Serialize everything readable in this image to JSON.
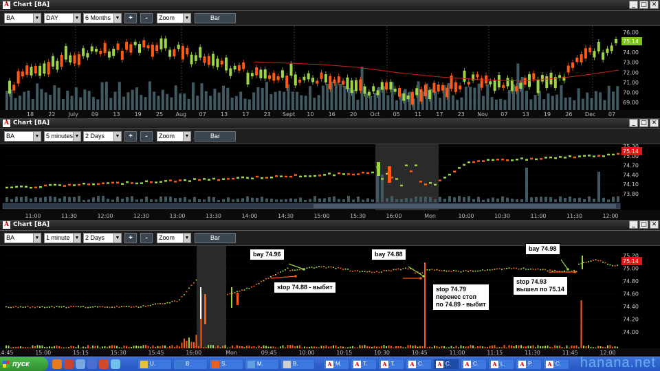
{
  "colors": {
    "up": "#9ed447",
    "down": "#ff5a14",
    "volume": "#3f5a62",
    "ma": "#d21e1e",
    "grid": "#3a3a3a",
    "price_tag_green": "#7cc417",
    "price_tag_red": "#e01818"
  },
  "windows": [
    {
      "title": "Chart [BA]",
      "symbol": "BA",
      "interval": "DAY",
      "range": "6 Months",
      "mode": "Zoom",
      "bar_label": "Bar",
      "plus": "+",
      "minus": "-",
      "last_price": "75.14",
      "x_labels": [
        "18",
        "22",
        "July",
        "09",
        "13",
        "19",
        "25",
        "Aug",
        "07",
        "13",
        "17",
        "23",
        "Sept",
        "10",
        "16",
        "20",
        "Oct",
        "05",
        "11",
        "17",
        "23",
        "Nov",
        "07",
        "13",
        "19",
        "26",
        "Dec",
        "07"
      ],
      "y_labels": [
        "76.00",
        "75.00",
        "74.00",
        "73.00",
        "72.00",
        "71.00",
        "70.00",
        "69.00"
      ]
    },
    {
      "title": "Chart [BA]",
      "symbol": "BA",
      "interval": "5 minutes",
      "range": "2 Days",
      "mode": "Zoom",
      "bar_label": "Bar",
      "plus": "+",
      "minus": "-",
      "last_price": "75.14",
      "x_labels": [
        "11:00",
        "11:30",
        "12:00",
        "12:30",
        "13:00",
        "13:30",
        "14:00",
        "14:30",
        "15:00",
        "15:30",
        "16:00",
        "Mon",
        "10:00",
        "10:30",
        "11:00",
        "11:30",
        "12:00"
      ],
      "y_labels": [
        "75.30",
        "75.00",
        "74.70",
        "74.40",
        "74.10",
        "73.80"
      ]
    },
    {
      "title": "Chart [BA]",
      "symbol": "BA",
      "interval": "1 minute",
      "range": "2 Days",
      "mode": "Zoom",
      "bar_label": "Bar",
      "plus": "+",
      "minus": "-",
      "last_price": "75.14",
      "x_labels": [
        "14:45",
        "15:00",
        "15:15",
        "15:30",
        "15:45",
        "16:00",
        "Mon",
        "09:45",
        "10:00",
        "10:15",
        "10:30",
        "10:45",
        "11:00",
        "11:15",
        "11:30",
        "11:45",
        "12:00"
      ],
      "y_labels": [
        "75.20",
        "75.00",
        "74.80",
        "74.60",
        "74.40",
        "74.20",
        "74.00"
      ],
      "annotations": [
        {
          "id": "bay1",
          "text": "bay 74.96"
        },
        {
          "id": "stop1",
          "text": "stop 74.88 - выбит"
        },
        {
          "id": "bay2",
          "text": "bay 74.88"
        },
        {
          "id": "stop2",
          "text": "stop 74.79\nперенес стоп\nпо 74.89 - выбит"
        },
        {
          "id": "bay3",
          "text": "bay 74.98"
        },
        {
          "id": "stop3",
          "text": "stop 74.93\nвышел по 75.14"
        }
      ]
    }
  ],
  "taskbar": {
    "start_label": "пуск",
    "tasks": [
      {
        "label": "U.",
        "icon": "app-icon"
      },
      {
        "label": "B.",
        "icon": "app-icon"
      },
      {
        "label": "S.",
        "icon": "app-icon"
      },
      {
        "label": "M.",
        "icon": "app-icon"
      },
      {
        "label": "B.",
        "icon": "app-icon"
      },
      {
        "label": "M.",
        "icon": "chart-app-icon"
      },
      {
        "label": "T.",
        "icon": "chart-app-icon"
      },
      {
        "label": "T.",
        "icon": "chart-app-icon"
      },
      {
        "label": "C.",
        "icon": "chart-app-icon"
      },
      {
        "label": "C.",
        "icon": "chart-app-icon"
      },
      {
        "label": "C.",
        "icon": "chart-app-icon"
      },
      {
        "label": "L.",
        "icon": "chart-app-icon"
      },
      {
        "label": "P.",
        "icon": "chart-app-icon"
      },
      {
        "label": "C.",
        "icon": "chart-app-icon"
      }
    ],
    "watermark": "hanana.net"
  }
}
